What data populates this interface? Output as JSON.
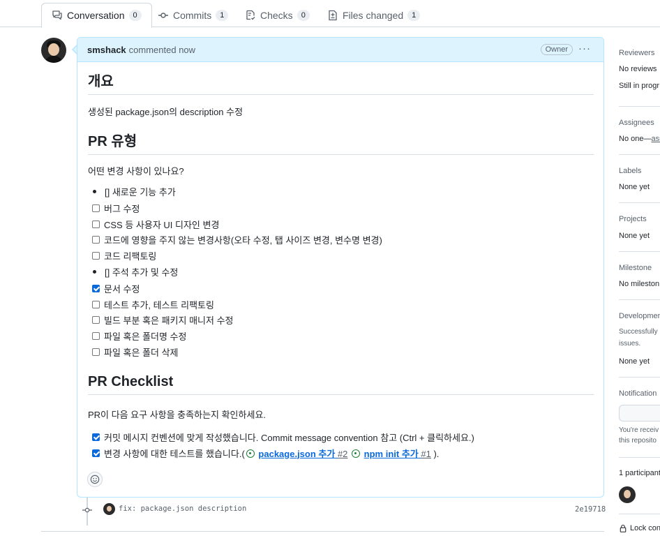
{
  "tabs": [
    {
      "label": "Conversation",
      "count": "0",
      "icon": "comment-discussion-icon"
    },
    {
      "label": "Commits",
      "count": "1",
      "icon": "git-commit-icon"
    },
    {
      "label": "Checks",
      "count": "0",
      "icon": "checklist-icon"
    },
    {
      "label": "Files changed",
      "count": "1",
      "icon": "file-diff-icon"
    }
  ],
  "comment": {
    "author": "smshack",
    "action": "commented now",
    "badge": "Owner",
    "menu": "···",
    "sections": {
      "overview_heading": "개요",
      "overview_text": "생성된 package.json의 description 수정",
      "type_heading": "PR 유형",
      "type_question": "어떤 변경 사항이 있나요?",
      "checklist_heading": "PR Checklist",
      "checklist_intro": "PR이 다음 요구 사항을 충족하는지 확인하세요."
    },
    "type_items": [
      {
        "kind": "bullet",
        "text": "[] 새로운 기능 추가"
      },
      {
        "kind": "checkbox",
        "checked": false,
        "text": "버그 수정"
      },
      {
        "kind": "checkbox",
        "checked": false,
        "text": "CSS 등 사용자 UI 디자인 변경"
      },
      {
        "kind": "checkbox",
        "checked": false,
        "text": "코드에 영향을 주지 않는 변경사항(오타 수정, 탭 사이즈 변경, 변수명 변경)"
      },
      {
        "kind": "checkbox",
        "checked": false,
        "text": "코드 리팩토링"
      },
      {
        "kind": "bullet",
        "text": "[] 주석 추가 및 수정"
      },
      {
        "kind": "checkbox",
        "checked": true,
        "text": "문서 수정"
      },
      {
        "kind": "checkbox",
        "checked": false,
        "text": "테스트 추가, 테스트 리팩토링"
      },
      {
        "kind": "checkbox",
        "checked": false,
        "text": "빌드 부분 혹은 패키지 매니저 수정"
      },
      {
        "kind": "checkbox",
        "checked": false,
        "text": "파일 혹은 폴더명 수정"
      },
      {
        "kind": "checkbox",
        "checked": false,
        "text": "파일 혹은 폴더 삭제"
      }
    ],
    "checklist_items": {
      "item1": "커밋 메시지 컨벤션에 맞게 작성했습니다. Commit message convention 참고 (Ctrl + 클릭하세요.)",
      "item2_prefix": "변경 사항에 대한 테스트를 했습니다.(",
      "item2_link1": "package.json 추가",
      "item2_link1_num": "#2",
      "item2_link2": "npm init 추가",
      "item2_link2_num": "#1",
      "item2_suffix": " )."
    }
  },
  "commit": {
    "message": "fix: package.json description",
    "sha": "2e19718"
  },
  "sidebar": {
    "reviewers_title": "Reviewers",
    "reviewers_value": "No reviews",
    "reviewers_note": "Still in progr",
    "assignees_title": "Assignees",
    "assignees_value_prefix": "No one—",
    "assignees_value_link": "ass",
    "labels_title": "Labels",
    "labels_value": "None yet",
    "projects_title": "Projects",
    "projects_value": "None yet",
    "milestone_title": "Milestone",
    "milestone_value": "No mileston",
    "development_title": "Developmen",
    "development_note1": "Successfully",
    "development_note2": "issues.",
    "development_value": "None yet",
    "notifications_title": "Notification",
    "notifications_note1": "You're receiv",
    "notifications_note2": "this reposito",
    "participants": "1 participant",
    "lock": "Lock con"
  }
}
